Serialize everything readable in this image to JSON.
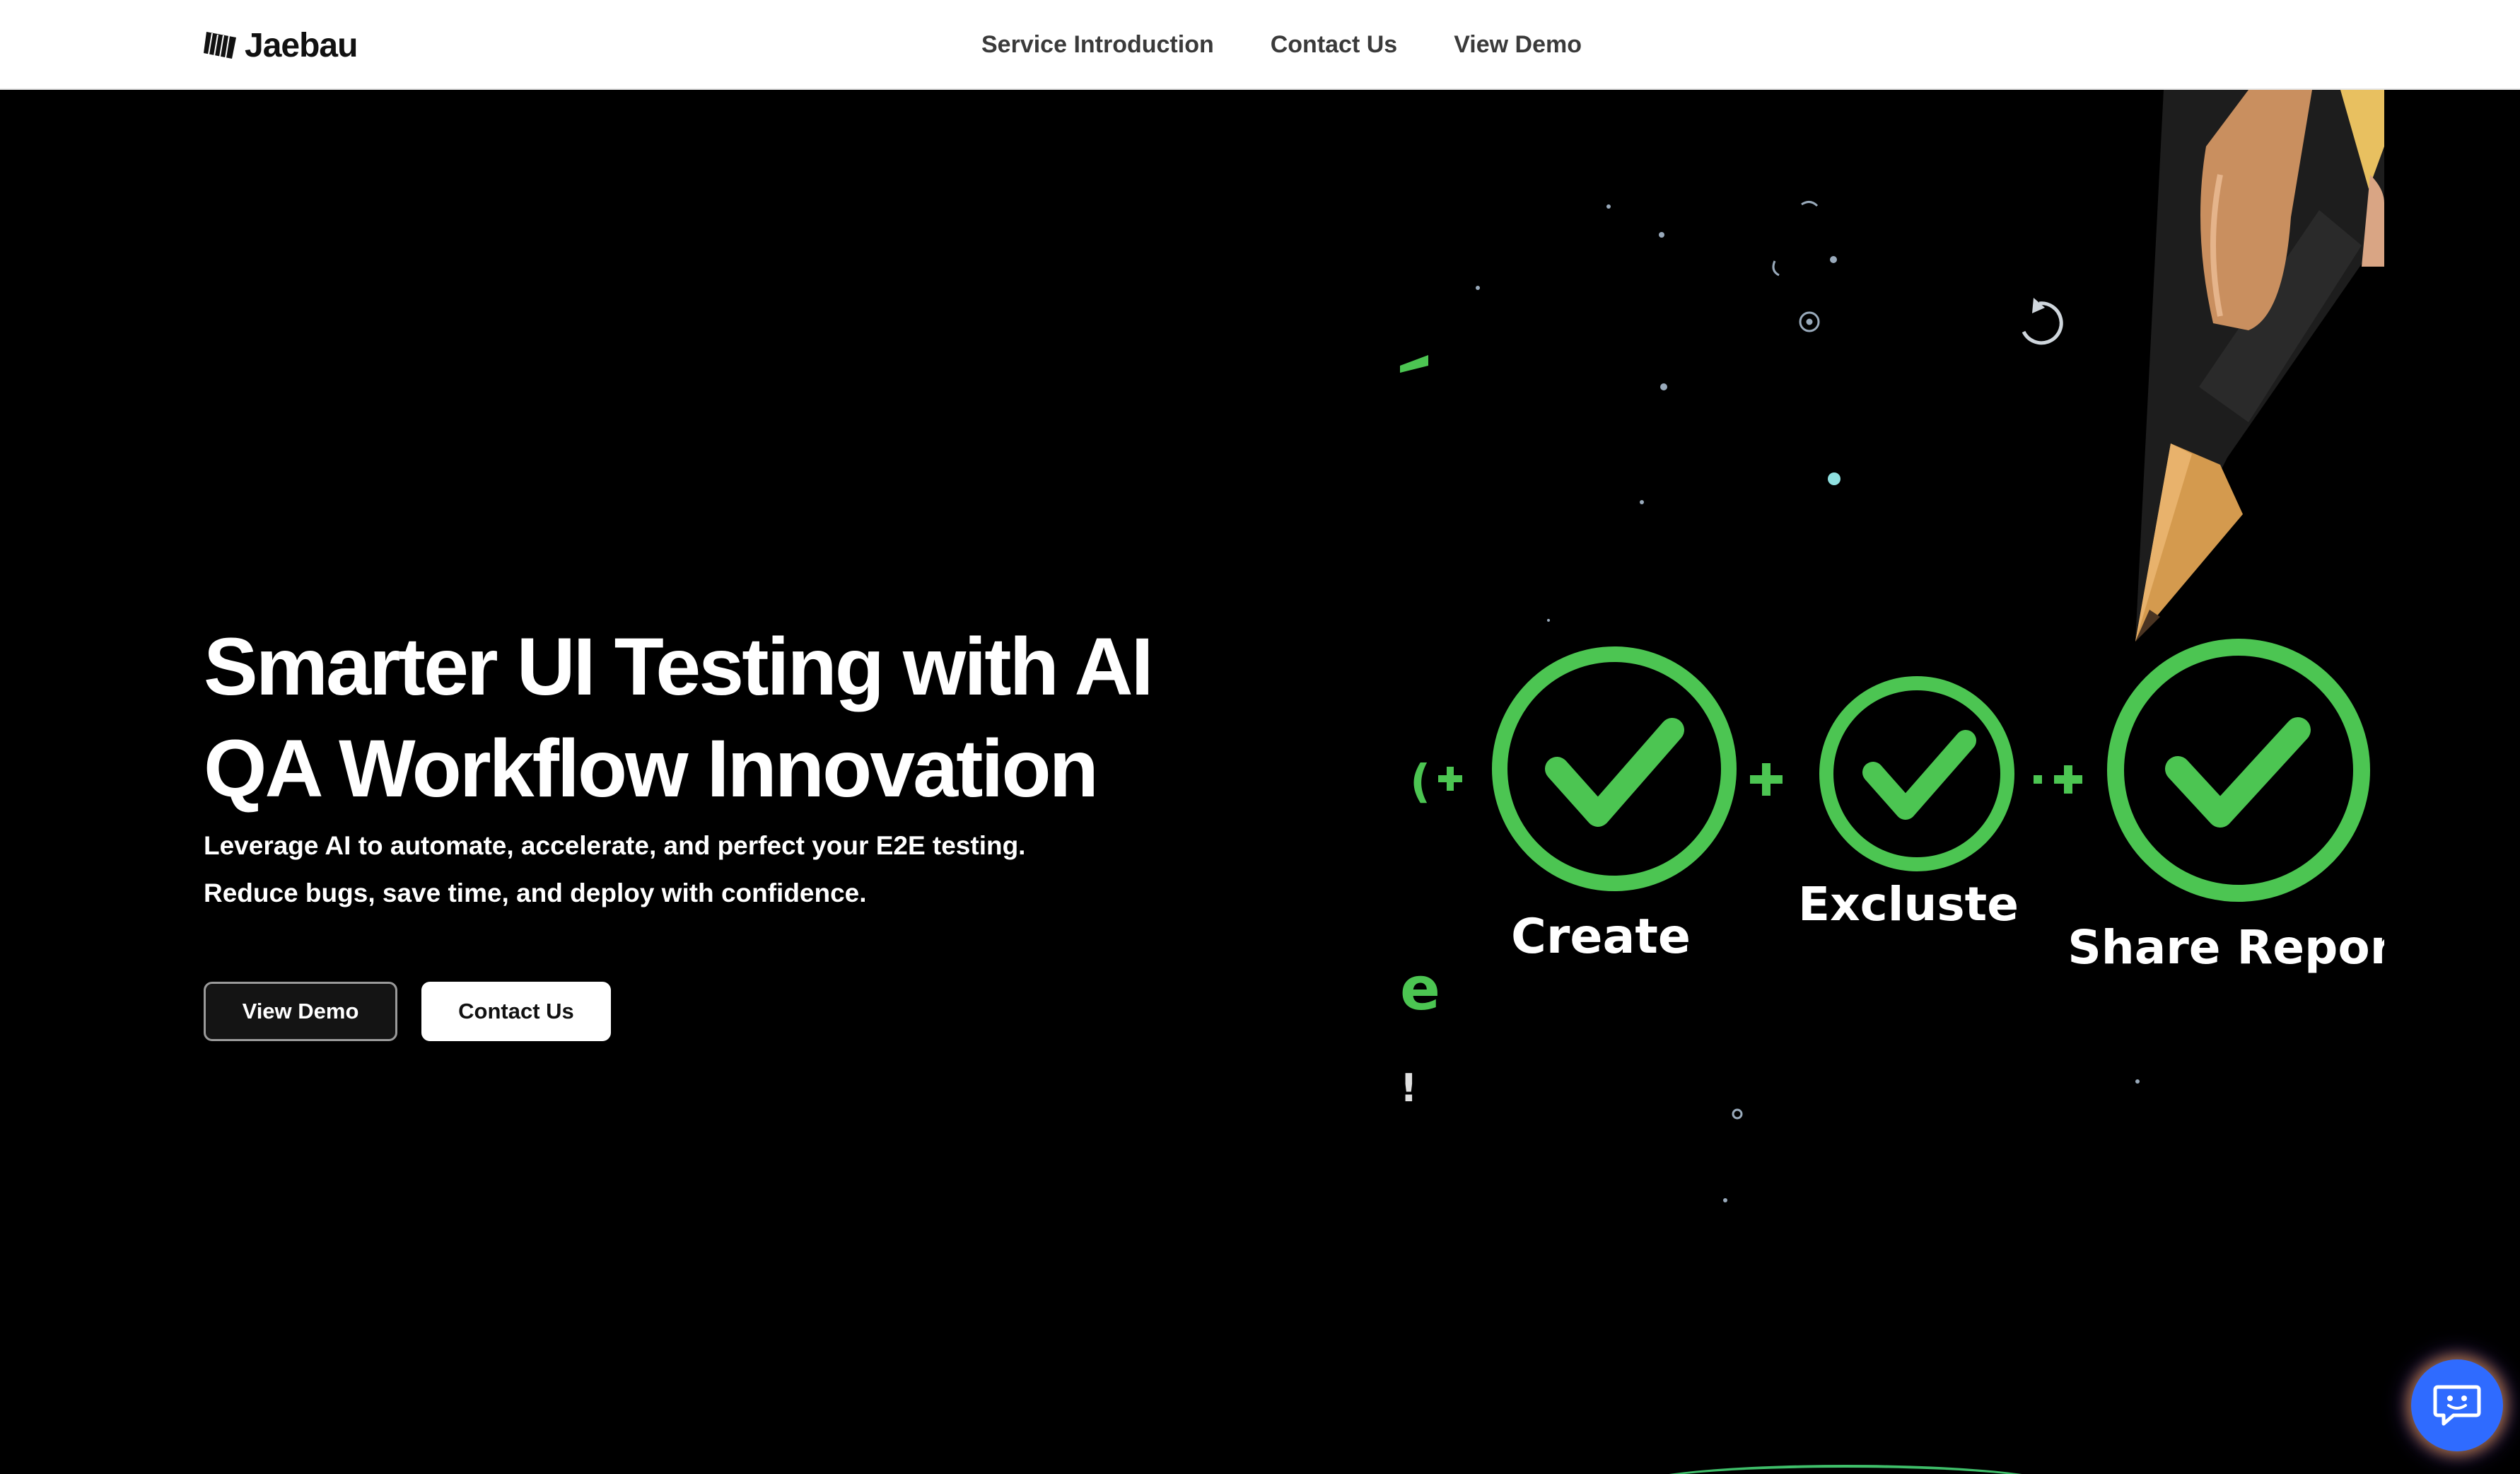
{
  "header": {
    "logo_text": "Jaebau",
    "nav": [
      {
        "label": "Service Introduction"
      },
      {
        "label": "Contact Us"
      },
      {
        "label": "View Demo"
      }
    ]
  },
  "hero": {
    "title_line1": "Smarter UI Testing with AI",
    "title_line2": "QA Workflow Innovation",
    "subtitle_line1": "Leverage AI to automate, accelerate, and perfect your E2E testing.",
    "subtitle_line2": "Reduce bugs, save time, and deploy with confidence.",
    "primary_button": "View Demo",
    "secondary_button": "Contact Us"
  },
  "visual": {
    "steps": [
      {
        "label": "Create"
      },
      {
        "label": "Excluste"
      },
      {
        "label": "Share Report"
      }
    ],
    "fragment_e": "e",
    "fragment_bang": "!",
    "accent_color": "#4cc552"
  },
  "chat": {
    "icon": "chat-bot-icon",
    "color": "#2f6bff"
  }
}
